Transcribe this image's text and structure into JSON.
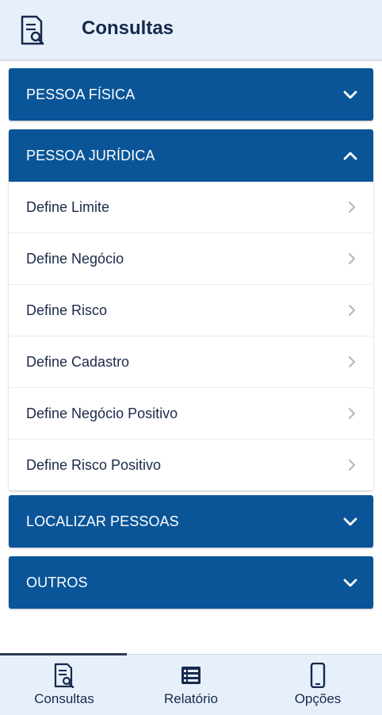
{
  "header": {
    "title": "Consultas",
    "icon": "document-search-icon"
  },
  "sections": [
    {
      "label": "PESSOA FÍSICA",
      "expanded": false
    },
    {
      "label": "PESSOA JURÍDICA",
      "expanded": true,
      "items": [
        "Define Limite",
        "Define Negócio",
        "Define Risco",
        "Define Cadastro",
        "Define Negócio Positivo",
        "Define Risco Positivo"
      ]
    },
    {
      "label": "LOCALIZAR PESSOAS",
      "expanded": false
    },
    {
      "label": "OUTROS",
      "expanded": false
    }
  ],
  "bottom_nav": {
    "items": [
      {
        "label": "Consultas",
        "icon": "document-search-icon",
        "active": true
      },
      {
        "label": "Relatório",
        "icon": "list-icon",
        "active": false
      },
      {
        "label": "Opções",
        "icon": "phone-icon",
        "active": false
      }
    ]
  },
  "colors": {
    "accent": "#0a5598",
    "header_bg": "#e7f0fa",
    "text": "#16294e"
  }
}
